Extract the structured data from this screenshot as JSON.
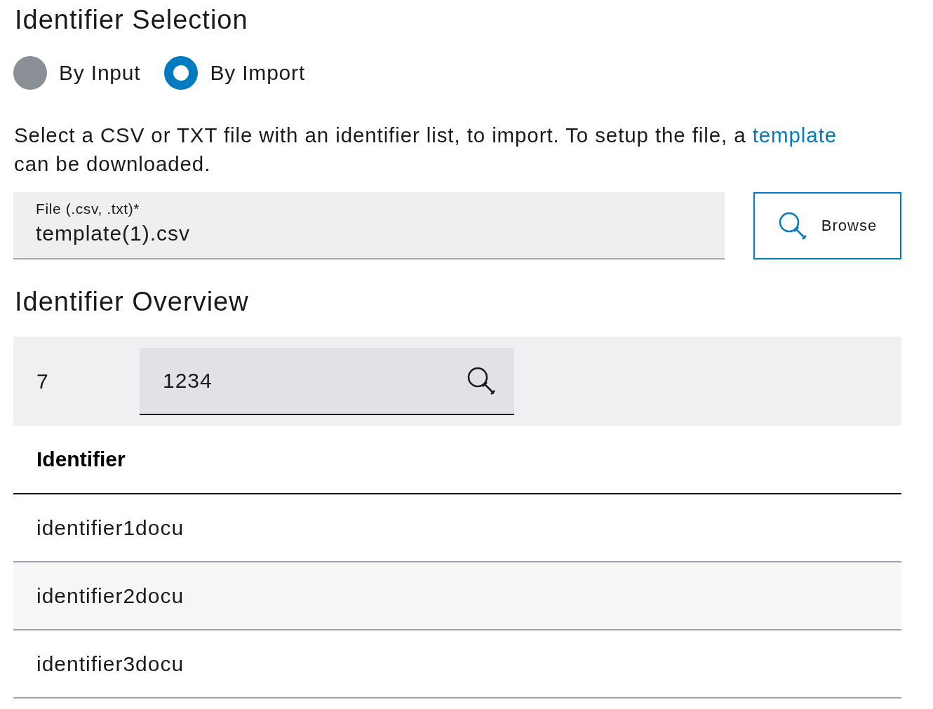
{
  "section_title": "Identifier Selection",
  "radios": [
    {
      "label": "By Input",
      "selected": false
    },
    {
      "label": "By Import",
      "selected": true
    }
  ],
  "description": {
    "before": "Select a CSV or TXT file with an identifier list, to import. To setup the file, a",
    "link": "template",
    "after": "can be downloaded."
  },
  "file_field": {
    "label": "File (.csv, .txt)*",
    "value": "template(1).csv"
  },
  "browse_button": "Browse",
  "overview_title": "Identifier Overview",
  "toolbar": {
    "count": "7",
    "search": {
      "value": "1234"
    }
  },
  "table": {
    "columns": [
      "Identifier"
    ],
    "rows": [
      [
        "identifier1docu"
      ],
      [
        "identifier2docu"
      ],
      [
        "identifier3docu"
      ]
    ]
  }
}
